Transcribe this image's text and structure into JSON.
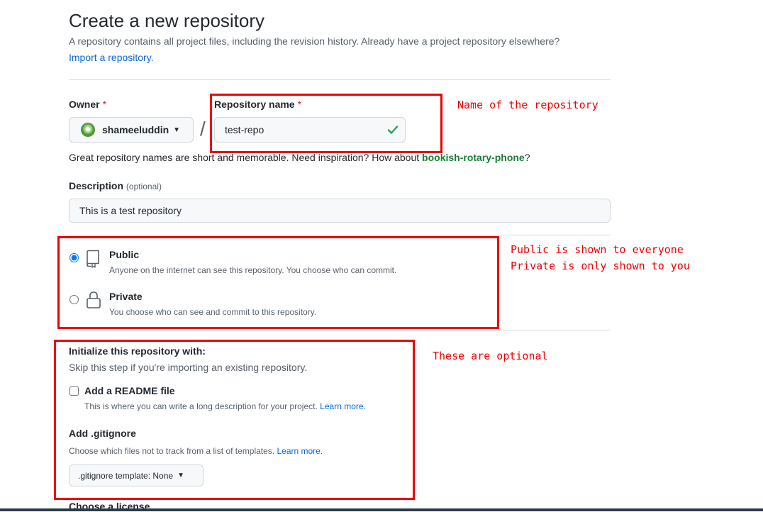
{
  "header": {
    "title": "Create a new repository",
    "subtitle": "A repository contains all project files, including the revision history. Already have a project repository elsewhere?",
    "import_link": "Import a repository."
  },
  "owner": {
    "label": "Owner",
    "required_mark": "*",
    "value": "shameeluddin"
  },
  "repo_name": {
    "label": "Repository name",
    "required_mark": "*",
    "value": "test-repo",
    "slash": "/"
  },
  "name_hint": {
    "text": "Great repository names are short and memorable. Need inspiration? How about",
    "suggestion": "bookish-rotary-phone",
    "end": "?"
  },
  "description": {
    "label": "Description",
    "optional": "(optional)",
    "value": "This is a test repository"
  },
  "visibility": {
    "public_title": "Public",
    "public_desc": "Anyone on the internet can see this repository. You choose who can commit.",
    "private_title": "Private",
    "private_desc": "You choose who can see and commit to this repository.",
    "selected": "Public"
  },
  "init": {
    "heading": "Initialize this repository with:",
    "sub": "Skip this step if you're importing an existing repository.",
    "readme_label": "Add a README file",
    "readme_desc": "This is where you can write a long description for your project.",
    "learn_more": "Learn more.",
    "readme_checked": false,
    "gitignore_heading": "Add .gitignore",
    "gitignore_desc": "Choose which files not to track from a list of templates.",
    "gitignore_button": ".gitignore template: None",
    "license_heading": "Choose a license"
  },
  "annotations": {
    "name_note": "Name of the repository",
    "visibility_note_1": "Public is shown to everyone",
    "visibility_note_2": "Private is only shown to you",
    "optional_note": "These are optional"
  },
  "colors": {
    "annotation": "#ee0000",
    "link": "#0969da",
    "suggestion": "#1a7f37",
    "check": "#2da44e"
  }
}
